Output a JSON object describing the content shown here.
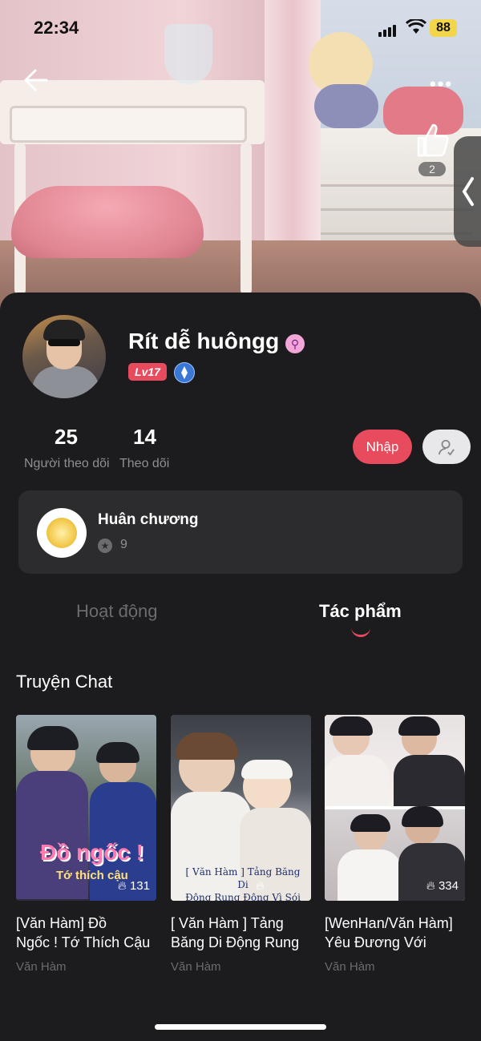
{
  "status_bar": {
    "time": "22:34",
    "battery": "88"
  },
  "header": {
    "more": "•••",
    "like_count": "2"
  },
  "profile": {
    "name": "Rít dễ huôngg",
    "gender_symbol": "⚲",
    "level": "Lv17",
    "followers": {
      "count": "25",
      "label": "Người theo dõi"
    },
    "following": {
      "count": "14",
      "label": "Theo dõi"
    },
    "join_label": "Nhập"
  },
  "medal": {
    "title": "Huân chương",
    "count": "9"
  },
  "tabs": [
    {
      "label": "Hoạt động",
      "active": false
    },
    {
      "label": "Tác phẩm",
      "active": true
    }
  ],
  "section": {
    "title": "Truyện Chat"
  },
  "stories": [
    {
      "title_line1": "[Văn Hàm] Đồ",
      "title_line2": "Ngốc ! Tớ Thích Cậu",
      "author": "Văn Hàm",
      "views": "131",
      "cover_text": "Đồ ngốc !",
      "cover_sub": "Tớ thích cậu"
    },
    {
      "title_line1": "[ Văn Hàm ] Tảng",
      "title_line2": "Băng Di Động Rung",
      "author": "Văn Hàm",
      "views": "",
      "cover_text": "[ Văn Hàm ] Tảng Băng Di",
      "cover_sub": "Động Rung Động Vì Sói"
    },
    {
      "title_line1": "[WenHan/Văn Hàm]",
      "title_line2": "Yêu Đương Với",
      "author": "Văn Hàm",
      "views": "334",
      "cover_text": "",
      "cover_sub": ""
    }
  ],
  "colors": {
    "accent": "#e94b5e",
    "background": "#1c1c1e",
    "card": "#2c2c2e"
  }
}
